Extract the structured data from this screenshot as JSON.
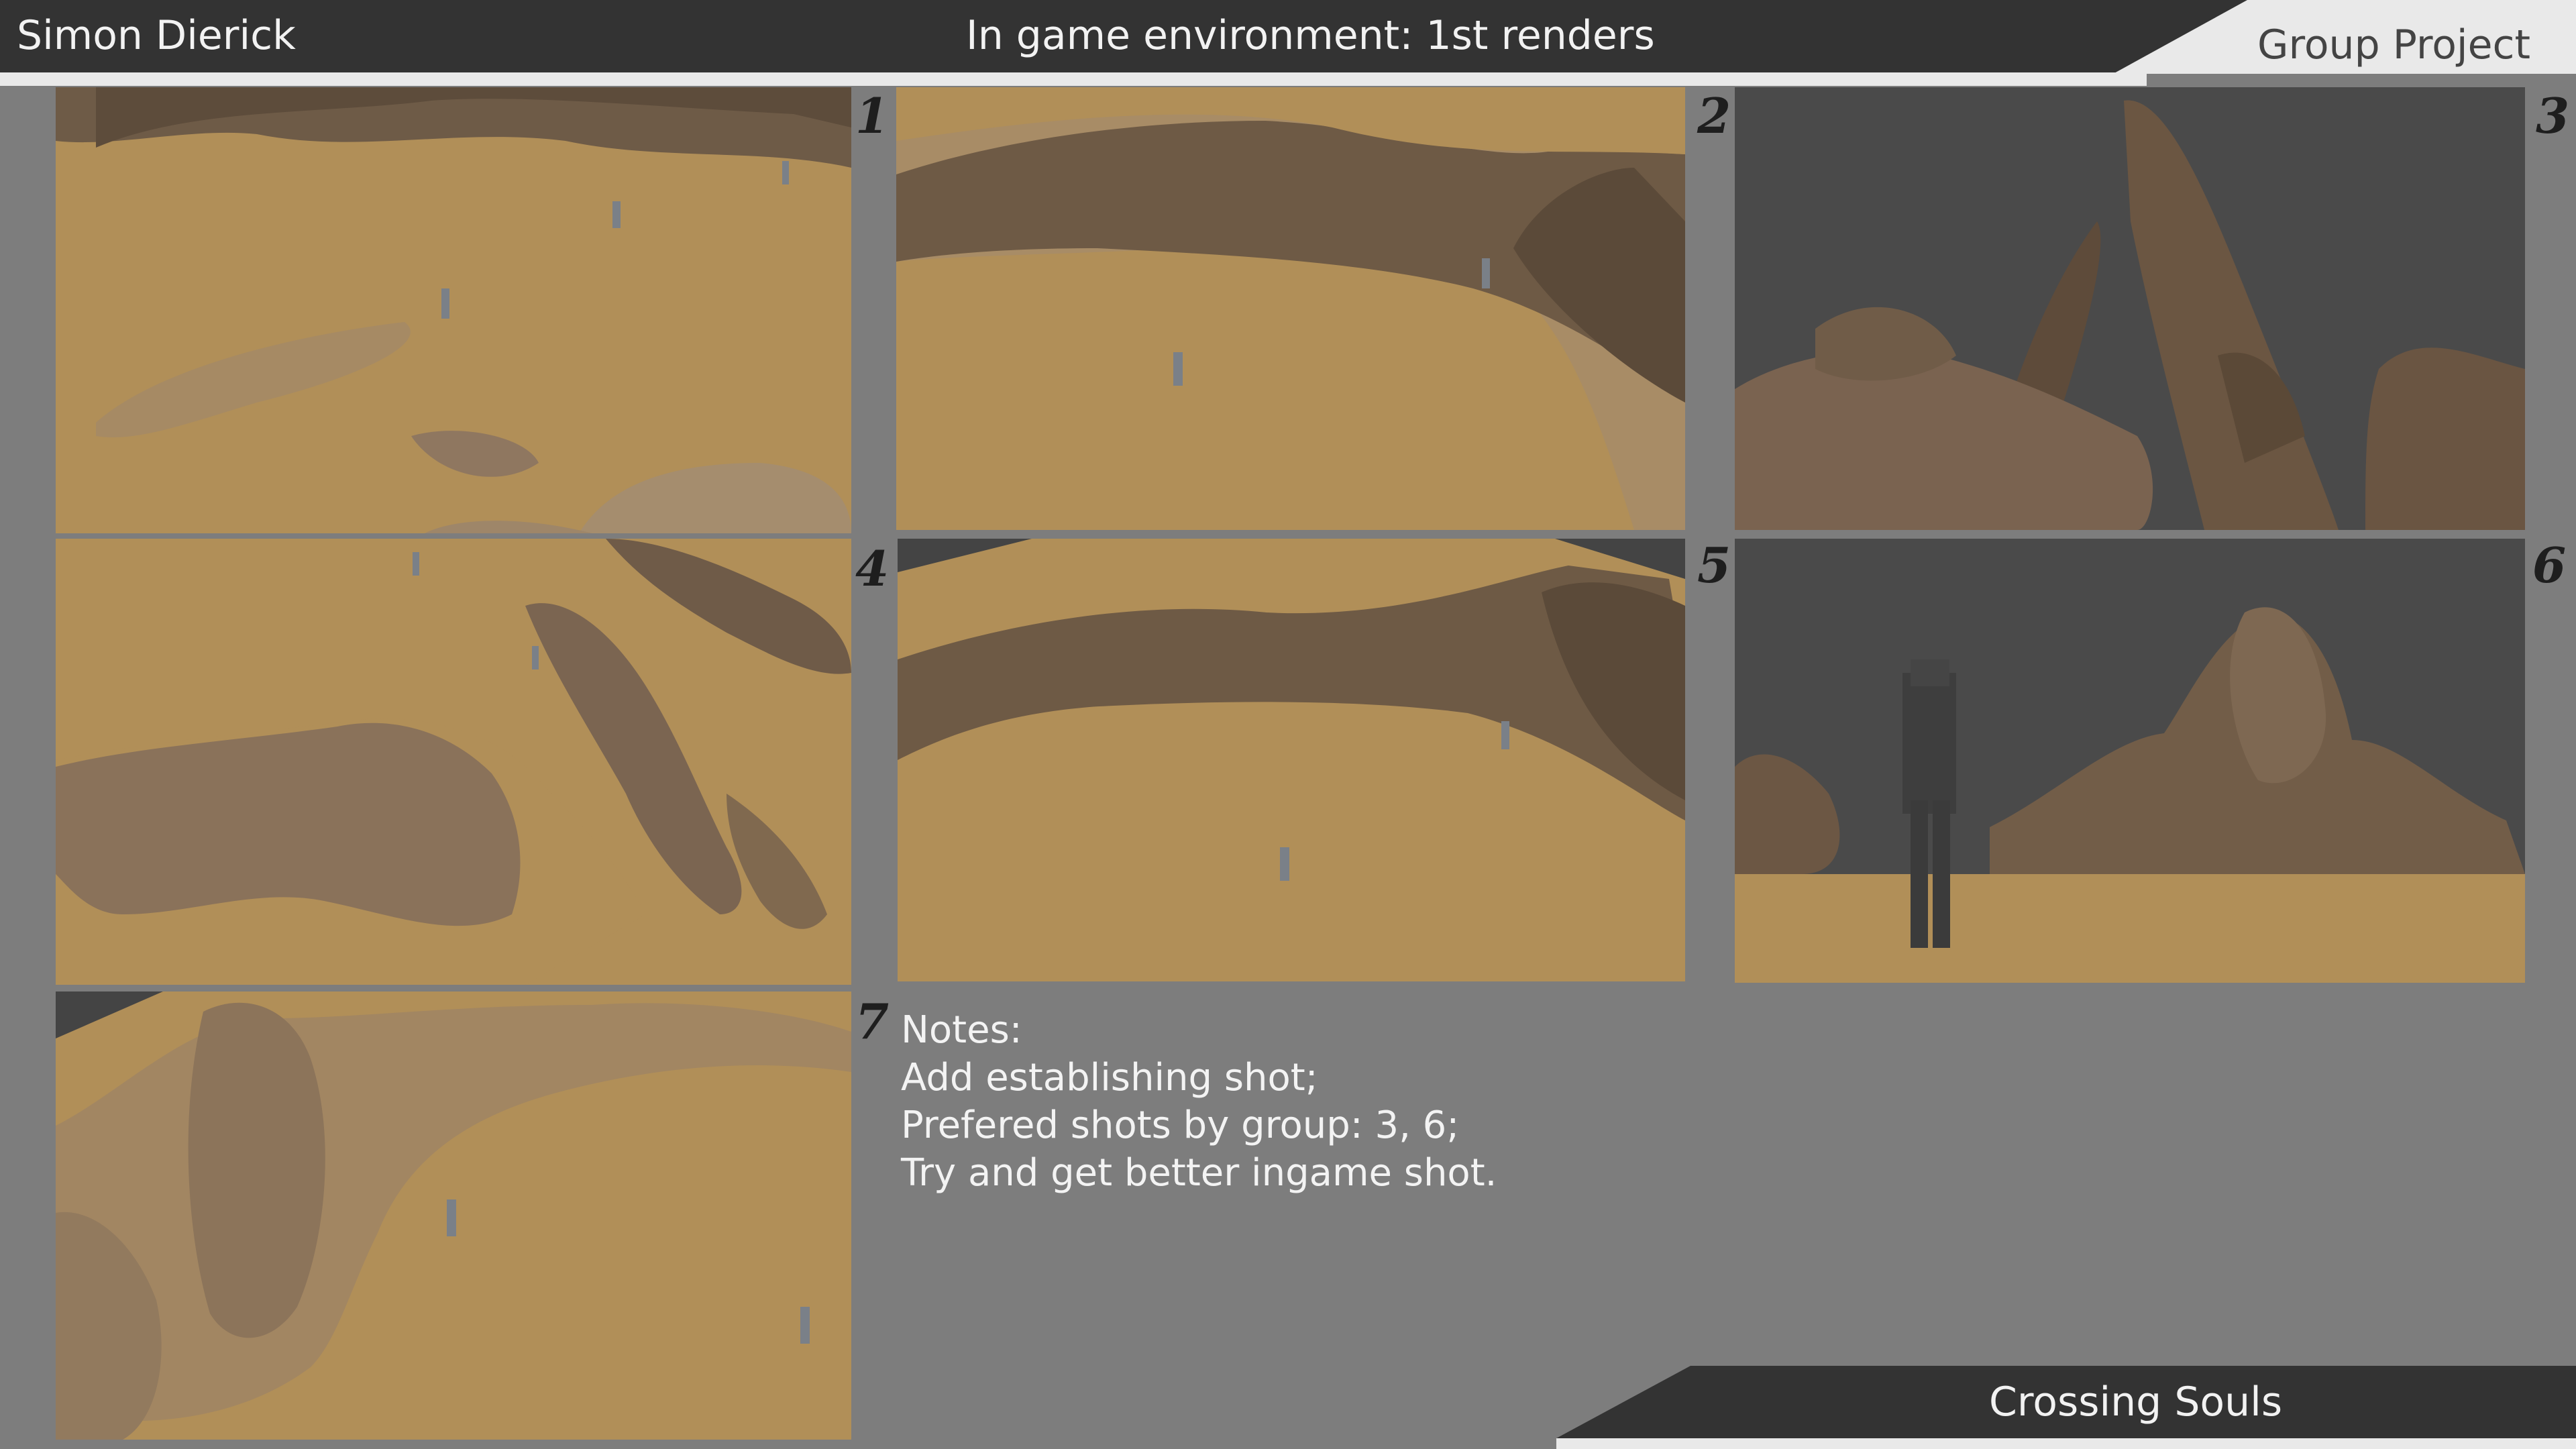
{
  "header": {
    "author": "Simon Dierick",
    "title": "In game environment: 1st renders",
    "group_label": "Group Project"
  },
  "panels": [
    {
      "number": "1",
      "description": "Sandy desert plain with flat rock slabs and three small figures"
    },
    {
      "number": "2",
      "description": "Curved rocky ridge across sand with two figures"
    },
    {
      "number": "3",
      "description": "Close-up of tall leaning rock spires against grey background"
    },
    {
      "number": "4",
      "description": "Top-down view of a winding rock formation with figures"
    },
    {
      "number": "5",
      "description": "Wide rocky arc bordering a sand field with two figures"
    },
    {
      "number": "6",
      "description": "Ground-level shot of a large figure facing rock formations"
    },
    {
      "number": "7",
      "description": "High-angle view of a rock ridge with two figures on sand"
    }
  ],
  "notes": {
    "heading": "Notes:",
    "lines": [
      "Add establishing shot;",
      "Prefered shots by group: 3, 6;",
      "Try and get better ingame shot."
    ]
  },
  "footer": {
    "title": "Crossing Souls"
  },
  "colors": {
    "background": "#7d7d7d",
    "header": "#333333",
    "sand": "#b18f58",
    "rock": "#7a6650",
    "sky": "#4a4a4a"
  }
}
